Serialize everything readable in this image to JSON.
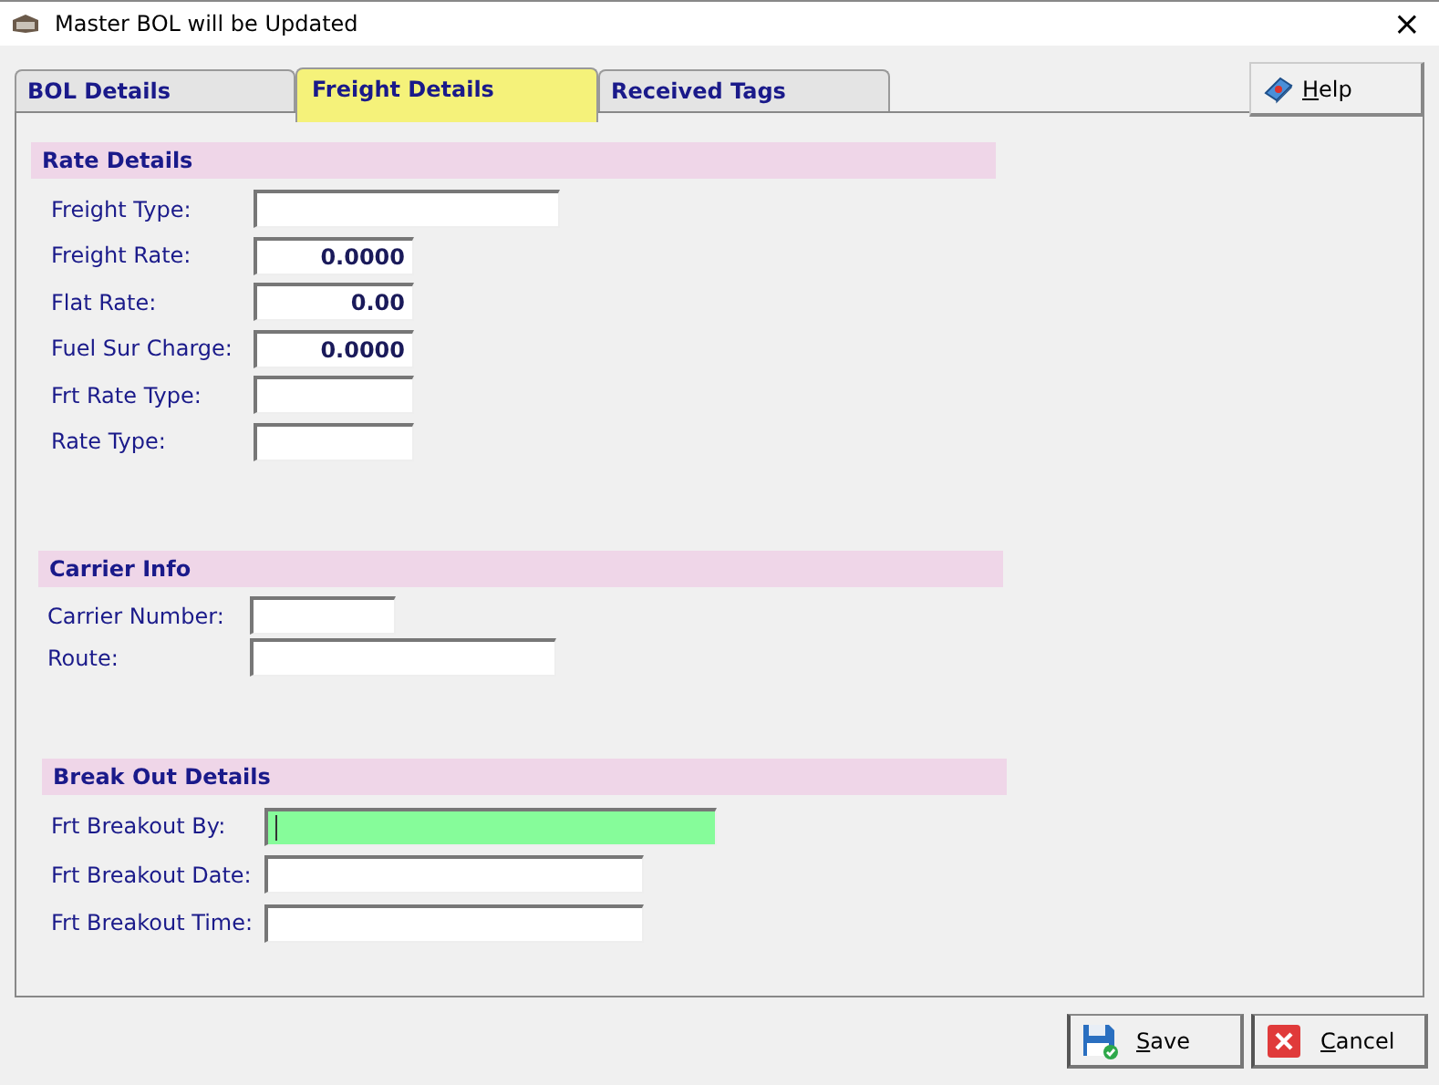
{
  "window": {
    "title": "Master BOL will be Updated",
    "close": "×"
  },
  "tabs": [
    {
      "label": "BOL Details",
      "selected": false
    },
    {
      "label": "Freight Details",
      "selected": true
    },
    {
      "label": "Received Tags",
      "selected": false
    }
  ],
  "help_button": {
    "label": "Help"
  },
  "sections": [
    {
      "title": "Rate Details",
      "fields": [
        {
          "label": "Freight Type:",
          "kind": "long",
          "focused": false
        },
        {
          "label": "Freight Rate:",
          "kind": "short",
          "value": "0.0000",
          "focused": false
        },
        {
          "label": "Flat Rate:",
          "kind": "short",
          "value": "0.00",
          "focused": false
        },
        {
          "label": "Fuel Sur Charge:",
          "kind": "short",
          "value": "0.0000",
          "focused": false
        },
        {
          "label": "Frt Rate Type:",
          "kind": "short",
          "focused": false
        },
        {
          "label": "Rate Type:",
          "kind": "short",
          "focused": false
        }
      ]
    },
    {
      "title": "Carrier Info",
      "fields": [
        {
          "label": "Carrier Number:",
          "kind": "tiny",
          "focused": false
        },
        {
          "label": "Route:",
          "kind": "long",
          "focused": false
        }
      ]
    },
    {
      "title": "Break Out Details",
      "fields": [
        {
          "label": "Frt Breakout By:",
          "kind": "wide",
          "focused": true
        },
        {
          "label": "Frt Breakout Date:",
          "kind": "medium",
          "focused": false
        },
        {
          "label": "Frt Breakout Time:",
          "kind": "medium",
          "focused": false
        }
      ]
    }
  ],
  "buttons": [
    {
      "label": "Save",
      "kind": "save"
    },
    {
      "label": "Cancel",
      "kind": "cancel"
    }
  ]
}
